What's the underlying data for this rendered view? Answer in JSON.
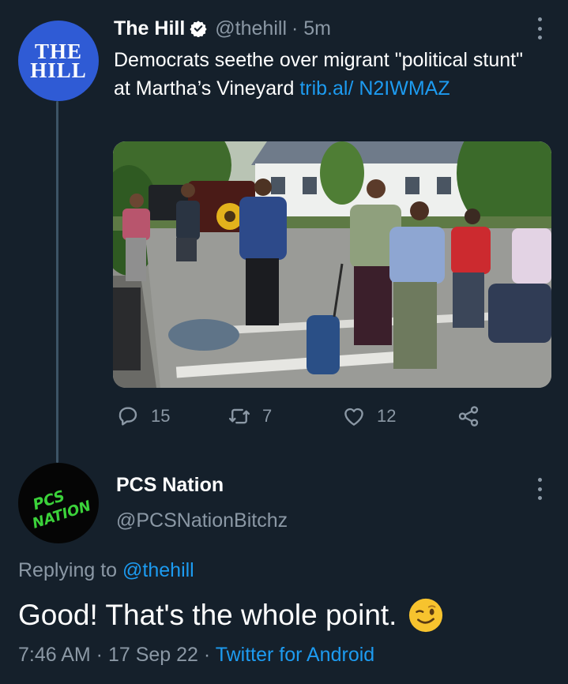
{
  "tweet": {
    "author_name": "The Hill",
    "author_handle": "@thehill",
    "time": "· 5m",
    "avatar_logo": "THE HILL",
    "text": "Democrats seethe over migrant \"political stunt\" at Martha’s Vineyard ",
    "link": "trib.al/ N2IWMAZ",
    "actions": {
      "replies": "15",
      "retweets": "7",
      "likes": "12"
    }
  },
  "reply": {
    "author_name": "PCS Nation",
    "author_handle": "@PCSNationBitchz",
    "avatar_logo": "PCS NATION",
    "replying_label": "Replying to ",
    "replying_handle": "@thehill",
    "text": "Good! That's the whole point.",
    "emoji": "winking-face-emoji",
    "timestamp": "7:46 AM · 17 Sep 22 · ",
    "client": "Twitter for Android"
  },
  "colors": {
    "background": "#15202b",
    "accent": "#1d9bf0",
    "muted": "#8b98a5",
    "hill_blue": "#2f5bd5",
    "pcs_green": "#3bd23a"
  }
}
